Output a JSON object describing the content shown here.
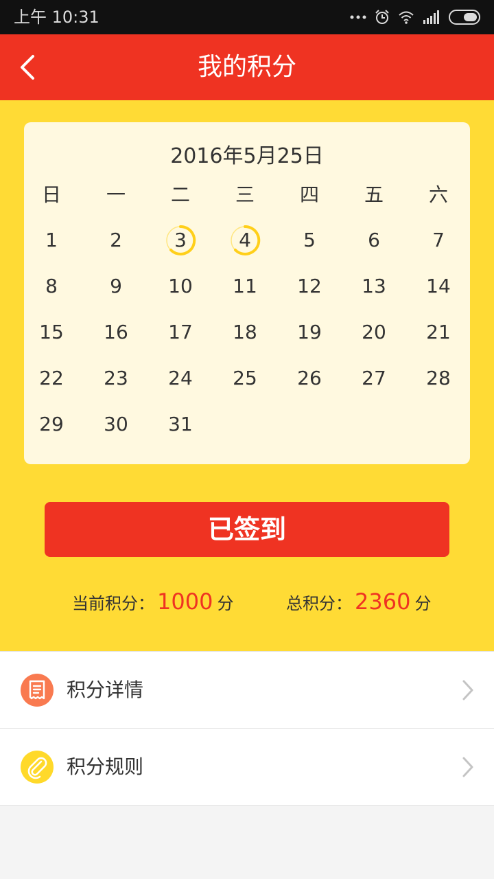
{
  "status_bar": {
    "time": "上午 10:31",
    "icons": [
      "more-icon",
      "alarm-icon",
      "wifi-icon",
      "signal-icon",
      "battery-icon"
    ]
  },
  "header": {
    "title": "我的积分",
    "back_icon": "chevron-left-icon"
  },
  "calendar": {
    "date_title": "2016年5月25日",
    "weekdays": [
      "日",
      "一",
      "二",
      "三",
      "四",
      "五",
      "六"
    ],
    "first_weekday_index": 0,
    "days": [
      "1",
      "2",
      "3",
      "4",
      "5",
      "6",
      "7",
      "8",
      "9",
      "10",
      "11",
      "12",
      "13",
      "14",
      "15",
      "16",
      "17",
      "18",
      "19",
      "20",
      "21",
      "22",
      "23",
      "24",
      "25",
      "26",
      "27",
      "28",
      "29",
      "30",
      "31"
    ],
    "signed_days": [
      "3",
      "4"
    ]
  },
  "signin_button": {
    "label": "已签到"
  },
  "points": {
    "current_label": "当前积分：",
    "current_value": "1000",
    "current_unit": "分",
    "total_label": "总积分：",
    "total_value": "2360",
    "total_unit": "分"
  },
  "menu": [
    {
      "label": "积分详情",
      "icon": "receipt-icon",
      "icon_color": "#f97a50"
    },
    {
      "label": "积分规则",
      "icon": "paperclip-icon",
      "icon_color": "#ffd92a"
    }
  ],
  "colors": {
    "primary_red": "#ef3322",
    "background_yellow": "#ffdb35",
    "calendar_bg": "#fff9e0",
    "signed_ring": "#ffcf1a"
  }
}
